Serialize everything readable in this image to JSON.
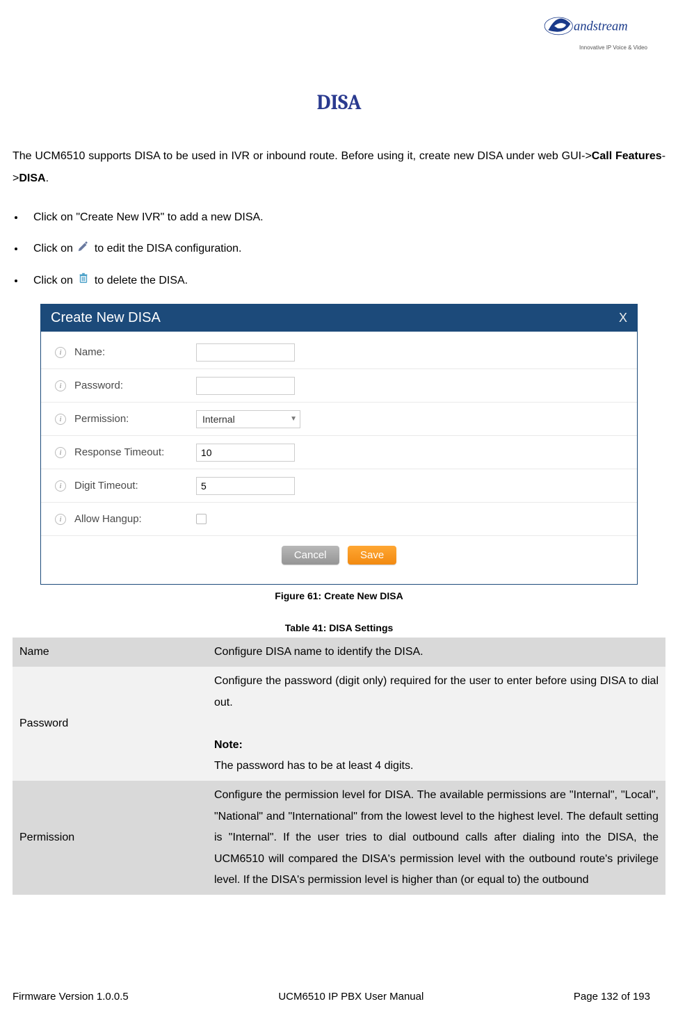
{
  "logo": {
    "name": "Grandstream",
    "tagline": "Innovative IP Voice & Video"
  },
  "title": "DISA",
  "intro": {
    "pre": "The UCM6510 supports DISA to be used in IVR or inbound route. Before using it, create new DISA under web GUI->",
    "b1": "Call Features",
    "mid": "->",
    "b2": "DISA",
    "post": "."
  },
  "bullets": {
    "b1": "Click on \"Create New IVR\" to add a new DISA.",
    "b2_pre": "Click on ",
    "b2_post": " to edit the DISA configuration.",
    "b3_pre": "Click on ",
    "b3_post": " to delete the DISA."
  },
  "modal": {
    "header": "Create New DISA",
    "close": "X",
    "labels": {
      "name": "Name:",
      "password": "Password:",
      "permission": "Permission:",
      "response_timeout": "Response Timeout:",
      "digit_timeout": "Digit Timeout:",
      "allow_hangup": "Allow Hangup:"
    },
    "values": {
      "name": "",
      "password": "",
      "permission": "Internal",
      "response_timeout": "10",
      "digit_timeout": "5"
    },
    "buttons": {
      "cancel": "Cancel",
      "save": "Save"
    }
  },
  "figure_caption": "Figure 61: Create New DISA",
  "table_caption": "Table 41: DISA Settings",
  "table": {
    "r1": {
      "key": "Name",
      "val": "Configure DISA name to identify the DISA."
    },
    "r2": {
      "key": "Password",
      "val_line1": "Configure the password (digit only) required for the user to enter before using DISA to dial out.",
      "note_label": "Note:",
      "note_text": "The password has to be at least 4 digits."
    },
    "r3": {
      "key": "Permission",
      "val": "Configure the permission level for DISA. The available permissions are \"Internal\", \"Local\", \"National\" and \"International\" from the lowest level to the highest level. The default setting is \"Internal\". If the user tries to dial outbound calls after dialing into the DISA, the UCM6510 will compared the DISA's permission level with the outbound route's privilege level. If the DISA's permission level is higher than (or equal to) the outbound"
    }
  },
  "footer": {
    "left": "Firmware Version 1.0.0.5",
    "center": "UCM6510 IP PBX User Manual",
    "right": "Page 132 of 193"
  }
}
